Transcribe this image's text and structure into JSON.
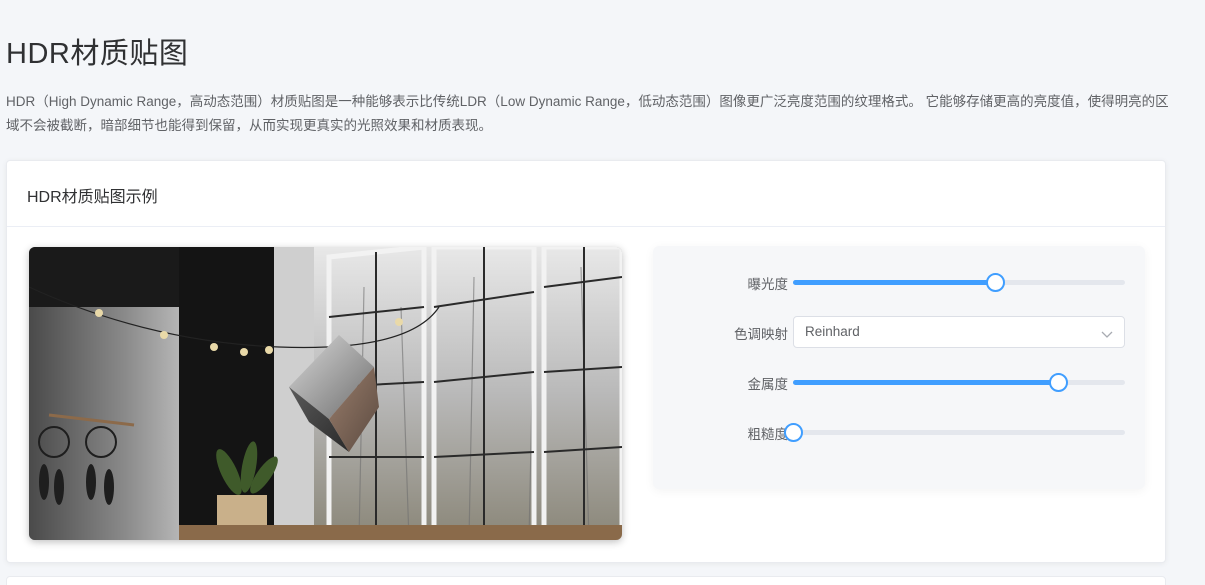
{
  "page": {
    "title": "HDR材质贴图",
    "description": "HDR（High Dynamic Range，高动态范围）材质贴图是一种能够表示比传统LDR（Low Dynamic Range，低动态范围）图像更广泛亮度范围的纹理格式。 它能够存储更高的亮度值，使得明亮的区域不会被截断，暗部细节也能得到保留，从而实现更真实的光照效果和材质表现。"
  },
  "card": {
    "title": "HDR材质贴图示例"
  },
  "controls": {
    "exposure": {
      "label": "曝光度",
      "value": 0.61
    },
    "tone_mapping": {
      "label": "色调映射",
      "value": "Reinhard"
    },
    "metalness": {
      "label": "金属度",
      "value": 0.8
    },
    "roughness": {
      "label": "粗糙度",
      "value": 0.0
    }
  },
  "colors": {
    "accent": "#409eff",
    "track": "#e4e7ed"
  },
  "icons": {
    "select_arrow": "chevron-down-icon"
  }
}
